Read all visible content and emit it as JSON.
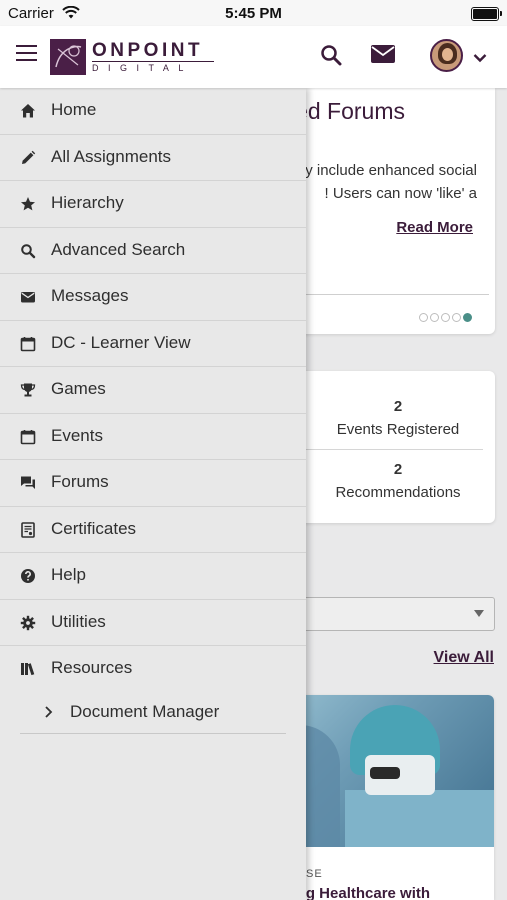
{
  "status_bar": {
    "carrier": "Carrier",
    "time": "5:45 PM"
  },
  "header": {
    "logo_word": "ONPOINT",
    "logo_sub": "DIGITAL",
    "icons": [
      "hamburger-icon",
      "search-icon",
      "mail-icon",
      "avatar",
      "chevron-down-icon"
    ],
    "brand_color": "#3b1c3a"
  },
  "drawer": {
    "items": [
      {
        "label": "Home",
        "icon": "home-icon"
      },
      {
        "label": "All Assignments",
        "icon": "pencil-icon"
      },
      {
        "label": "Hierarchy",
        "icon": "star-icon"
      },
      {
        "label": "Advanced Search",
        "icon": "search-icon"
      },
      {
        "label": "Messages",
        "icon": "mail-icon"
      },
      {
        "label": "DC - Learner View",
        "icon": "calendar-icon"
      },
      {
        "label": "Games",
        "icon": "trophy-icon"
      },
      {
        "label": "Events",
        "icon": "calendar-icon"
      },
      {
        "label": "Forums",
        "icon": "forum-icon"
      },
      {
        "label": "Certificates",
        "icon": "certificate-icon"
      },
      {
        "label": "Help",
        "icon": "help-icon"
      },
      {
        "label": "Utilities",
        "icon": "gear-icon"
      },
      {
        "label": "Resources",
        "icon": "library-icon"
      }
    ],
    "sub_items": [
      {
        "label": "Document Manager",
        "icon": "chevron-right-icon"
      }
    ]
  },
  "background": {
    "news": {
      "title_fragment": "ed Forums",
      "body_line1": "y include enhanced social",
      "body_line2": "! Users can now 'like' a",
      "read_more": "Read More",
      "carousel_dots": 5,
      "active_dot": 5
    },
    "stats": [
      {
        "value": "2",
        "label": "Events Registered"
      },
      {
        "value": "2",
        "label": "Recommendations"
      }
    ],
    "view_all": "View All",
    "course": {
      "type_fragment": "SE",
      "title_fragment": "vering Healthcare with"
    },
    "accent_color": "#4a8f88"
  }
}
